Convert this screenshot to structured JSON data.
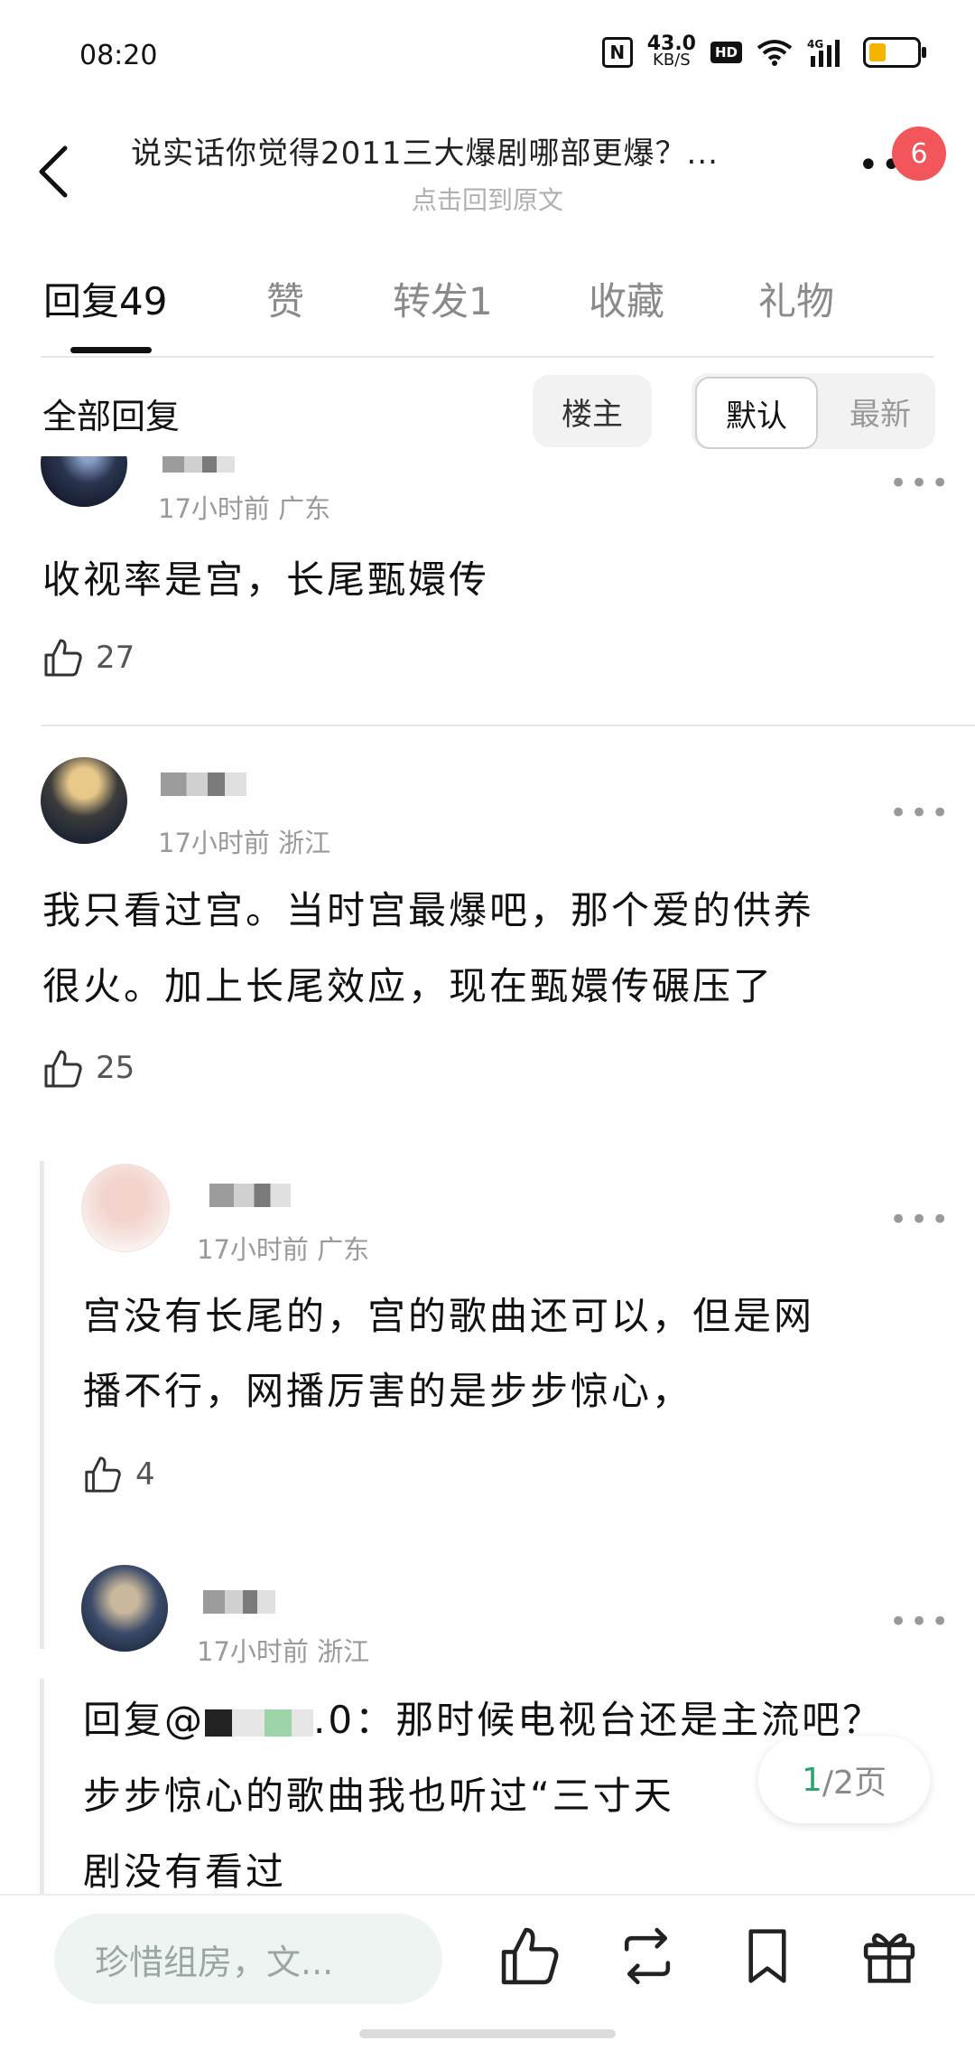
{
  "status_bar": {
    "time": "08:20",
    "speed": "43.0",
    "speed_unit": "KB/S",
    "hd": "HD",
    "network": "4G"
  },
  "header": {
    "title": "说实话你觉得2011三大爆剧哪部更爆？...",
    "subtitle": "点击回到原文",
    "notification_count": "6"
  },
  "tabs": [
    {
      "label": "回复49",
      "active": true
    },
    {
      "label": "赞"
    },
    {
      "label": "转发1"
    },
    {
      "label": "收藏"
    },
    {
      "label": "礼物"
    }
  ],
  "filter": {
    "label": "全部回复",
    "op_only": "楼主",
    "sort_default": "默认",
    "sort_latest": "最新"
  },
  "comments": [
    {
      "meta": "17小时前 广东",
      "text": "收视率是宫，长尾甄嬛传",
      "likes": "27"
    },
    {
      "meta": "17小时前 浙江",
      "text_line1": "我只看过宫。当时宫最爆吧，那个爱的供养",
      "text_line2": "很火。加上长尾效应，现在甄嬛传碾压了",
      "likes": "25"
    },
    {
      "meta": "17小时前 广东",
      "text_line1": "宫没有长尾的，宫的歌曲还可以，但是网",
      "text_line2": "播不行，网播厉害的是步步惊心，",
      "likes": "4"
    },
    {
      "meta": "17小时前 浙江",
      "reply_prefix": "回复@",
      "reply_suffix": ".0：那时候电视台还是主流吧？",
      "text_line2": "步步惊心的歌曲我也听过“三寸天",
      "text_line3": "剧没有看过"
    }
  ],
  "pager": {
    "current": "1",
    "total_text": "/2页"
  },
  "bottom_bar": {
    "composer_placeholder": "珍惜组房，文..."
  }
}
